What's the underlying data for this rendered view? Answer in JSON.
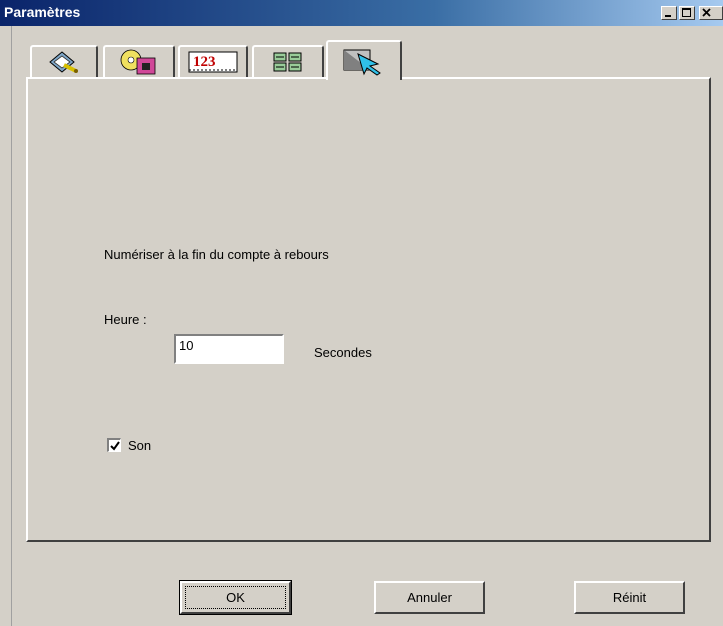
{
  "window": {
    "title": "Paramètres"
  },
  "tabs": [
    {
      "icon": "wrench-settings-icon",
      "active": false
    },
    {
      "icon": "media-card-icon",
      "active": false
    },
    {
      "icon": "numbering-123-icon",
      "active": false
    },
    {
      "icon": "batch-documents-icon",
      "active": false
    },
    {
      "icon": "cursor-arrow-icon",
      "active": true
    }
  ],
  "panel": {
    "description": "Numériser à la fin du compte à rebours",
    "time_label": "Heure :",
    "time_value": "10",
    "time_unit": "Secondes",
    "sound_label": "Son",
    "sound_checked": true
  },
  "buttons": {
    "ok": "OK",
    "cancel": "Annuler",
    "reset": "Réinit"
  }
}
